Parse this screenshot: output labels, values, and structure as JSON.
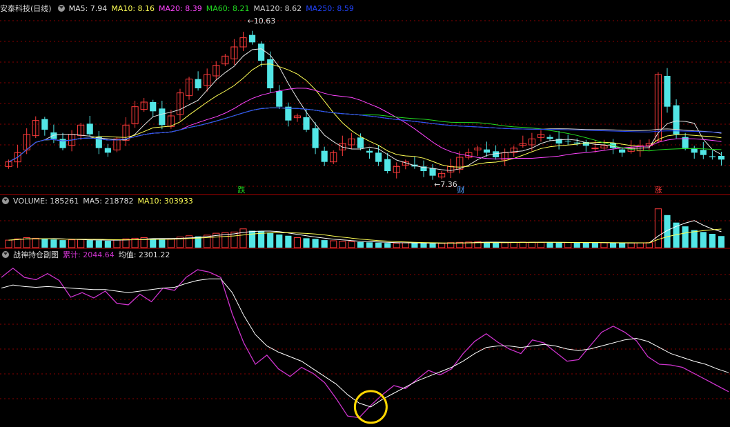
{
  "colors": {
    "up": "#ff3b3b",
    "down": "#52e6e6",
    "ma5": "#e6e6e6",
    "ma10": "#ffff55",
    "ma20": "#ff44ff",
    "ma60": "#22dd22",
    "ma120": "#d0d0d0",
    "ma250": "#2244ff",
    "vol_ma5": "#ffffff",
    "vol_ma10": "#ffff55",
    "sub_sum": "#cc33cc",
    "sub_avg": "#ffffff",
    "circle": "#ffd700",
    "grid": "#8b0000"
  },
  "price_legend": {
    "title": "安泰科技(日线)",
    "ma5": "MA5: 7.94",
    "ma10": "MA10: 8.16",
    "ma20": "MA20: 8.39",
    "ma60": "MA60: 8.21",
    "ma120": "MA120: 8.62",
    "ma250": "MA250: 8.59"
  },
  "volume_legend": {
    "volume": "VOLUME: 185261",
    "ma5": "MA5: 218782",
    "ma10": "MA10: 303933"
  },
  "sub_legend": {
    "title": "战神持仓副图",
    "sum": "累计: 2044.64",
    "avg": "均值: 2301.22"
  },
  "chart_data": [
    {
      "type": "candlestick",
      "panel": "price",
      "annotations": [
        {
          "text": "10.63",
          "kind": "high"
        },
        {
          "text": "7.36",
          "kind": "low"
        }
      ],
      "markers": [
        {
          "text": "跌",
          "color": "#22dd22"
        },
        {
          "text": "财",
          "color": "#52a0ff"
        },
        {
          "text": "涨",
          "color": "#ff3b3b"
        }
      ],
      "close_series": [
        7.7,
        7.9,
        8.3,
        8.6,
        8.4,
        8.2,
        8.0,
        8.3,
        8.5,
        8.3,
        8.0,
        7.9,
        8.2,
        8.5,
        8.9,
        9.0,
        8.8,
        8.5,
        8.7,
        9.2,
        9.5,
        9.3,
        9.6,
        9.8,
        10.0,
        10.2,
        10.4,
        10.3,
        9.9,
        9.3,
        8.9,
        8.6,
        8.7,
        8.4,
        8.0,
        7.7,
        7.9,
        8.1,
        8.2,
        8.0,
        7.9,
        7.7,
        7.5,
        7.6,
        7.7,
        7.6,
        7.5,
        7.4,
        7.45,
        7.6,
        7.8,
        7.9,
        8.0,
        7.9,
        7.8,
        7.9,
        8.0,
        8.1,
        8.2,
        8.3,
        8.2,
        8.1,
        8.15,
        8.1,
        8.05,
        8.0,
        8.05,
        8.0,
        7.9,
        8.0,
        8.05,
        8.1,
        9.6,
        8.9,
        8.3,
        8.0,
        7.9,
        7.85,
        7.8,
        7.75
      ]
    },
    {
      "type": "bar",
      "panel": "volume",
      "values": [
        120,
        140,
        160,
        150,
        140,
        130,
        120,
        125,
        130,
        120,
        115,
        110,
        125,
        140,
        150,
        160,
        145,
        130,
        140,
        170,
        190,
        180,
        200,
        230,
        240,
        250,
        300,
        270,
        260,
        240,
        210,
        190,
        160,
        150,
        140,
        120,
        110,
        100,
        95,
        90,
        85,
        80,
        75,
        70,
        78,
        76,
        70,
        65,
        68,
        80,
        85,
        90,
        95,
        88,
        82,
        80,
        85,
        88,
        86,
        84,
        82,
        80,
        82,
        80,
        78,
        76,
        78,
        75,
        72,
        75,
        78,
        80,
        620,
        520,
        400,
        340,
        280,
        250,
        220,
        185
      ]
    },
    {
      "type": "line",
      "panel": "sub",
      "series": [
        {
          "name": "累计",
          "values": [
            2900,
            3020,
            2900,
            2870,
            2950,
            2860,
            2640,
            2700,
            2630,
            2720,
            2560,
            2540,
            2680,
            2580,
            2760,
            2730,
            2900,
            3000,
            2970,
            2900,
            2420,
            2040,
            1760,
            1880,
            1700,
            1600,
            1720,
            1640,
            1520,
            1310,
            1080,
            1060,
            1220,
            1360,
            1480,
            1440,
            1560,
            1680,
            1620,
            1700,
            1900,
            2060,
            2160,
            2050,
            1960,
            1900,
            2080,
            2040,
            1920,
            1800,
            1820,
            2000,
            2180,
            2260,
            2180,
            2070,
            1860,
            1760,
            1750,
            1720,
            1640,
            1560,
            1480,
            1400
          ]
        },
        {
          "name": "均值",
          "values": [
            2760,
            2800,
            2780,
            2770,
            2780,
            2770,
            2760,
            2750,
            2740,
            2740,
            2720,
            2700,
            2720,
            2740,
            2760,
            2770,
            2820,
            2860,
            2880,
            2880,
            2700,
            2400,
            2150,
            2000,
            1920,
            1860,
            1800,
            1700,
            1600,
            1500,
            1360,
            1250,
            1200,
            1300,
            1380,
            1460,
            1540,
            1600,
            1660,
            1720,
            1800,
            1900,
            1980,
            2000,
            2000,
            1980,
            2000,
            2020,
            2000,
            1960,
            1940,
            1960,
            2000,
            2040,
            2080,
            2100,
            2060,
            1980,
            1900,
            1850,
            1800,
            1760,
            1700,
            1650
          ]
        }
      ],
      "highlight": "circle"
    }
  ]
}
